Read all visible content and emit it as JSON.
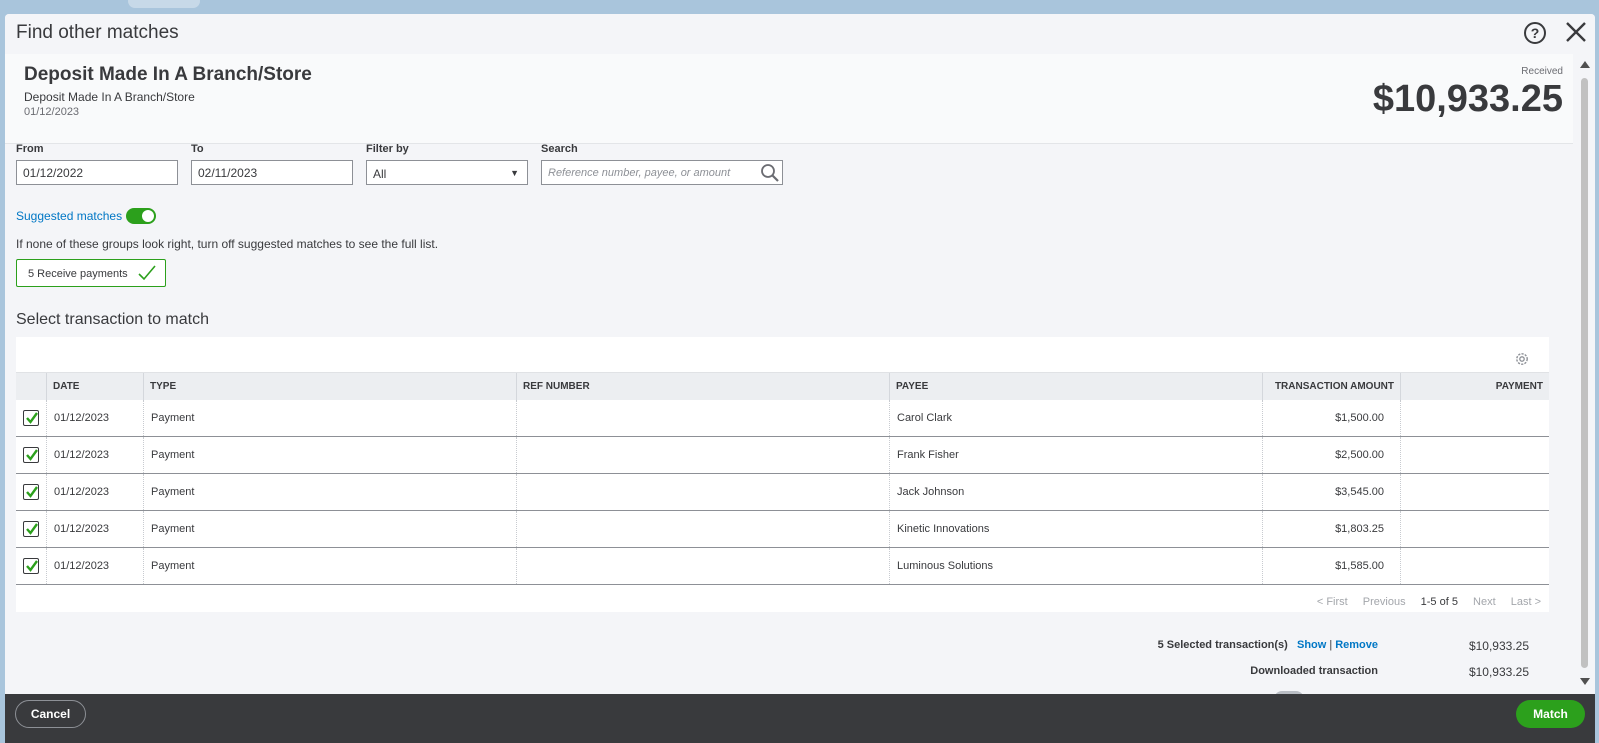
{
  "modal": {
    "title": "Find other matches"
  },
  "transaction": {
    "title": "Deposit Made In A Branch/Store",
    "description": "Deposit Made In A Branch/Store",
    "date": "01/12/2023",
    "received_label": "Received",
    "amount": "$10,933.25"
  },
  "filters": {
    "from_label": "From",
    "from_value": "01/12/2022",
    "to_label": "To",
    "to_value": "02/11/2023",
    "filter_label": "Filter by",
    "filter_value": "All",
    "search_label": "Search",
    "search_placeholder": "Reference number, payee, or amount"
  },
  "suggested": {
    "label": "Suggested matches",
    "enabled": true,
    "hint": "If none of these groups look right, turn off suggested matches to see the full list.",
    "group_label": "5 Receive payments"
  },
  "table": {
    "section_title": "Select transaction to match",
    "columns": [
      "DATE",
      "TYPE",
      "REF NUMBER",
      "PAYEE",
      "TRANSACTION AMOUNT",
      "PAYMENT"
    ],
    "rows": [
      {
        "checked": true,
        "date": "01/12/2023",
        "type": "Payment",
        "ref": "",
        "payee": "Carol Clark",
        "amount": "$1,500.00",
        "payment": ""
      },
      {
        "checked": true,
        "date": "01/12/2023",
        "type": "Payment",
        "ref": "",
        "payee": "Frank Fisher",
        "amount": "$2,500.00",
        "payment": ""
      },
      {
        "checked": true,
        "date": "01/12/2023",
        "type": "Payment",
        "ref": "",
        "payee": "Jack Johnson",
        "amount": "$3,545.00",
        "payment": ""
      },
      {
        "checked": true,
        "date": "01/12/2023",
        "type": "Payment",
        "ref": "",
        "payee": "Kinetic Innovations",
        "amount": "$1,803.25",
        "payment": ""
      },
      {
        "checked": true,
        "date": "01/12/2023",
        "type": "Payment",
        "ref": "",
        "payee": "Luminous Solutions",
        "amount": "$1,585.00",
        "payment": ""
      }
    ]
  },
  "pager": {
    "first": "< First",
    "previous": "Previous",
    "range": "1-5 of 5",
    "next": "Next",
    "last": "Last >"
  },
  "totals": {
    "selected_label": "5 Selected transaction(s)",
    "show_label": "Show",
    "separator": "|",
    "remove_label": "Remove",
    "selected_value": "$10,933.25",
    "downloaded_label": "Downloaded transaction",
    "downloaded_value": "$10,933.25"
  },
  "footer": {
    "cancel_label": "Cancel",
    "match_label": "Match"
  },
  "colors": {
    "accent_green": "#2ca01c",
    "link_blue": "#0077c5",
    "footer_dark": "#393a3d"
  }
}
